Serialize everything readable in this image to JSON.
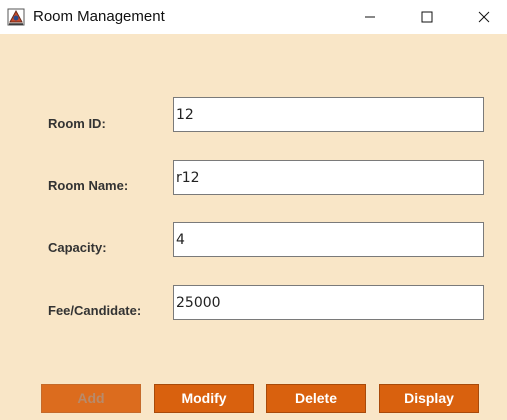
{
  "window": {
    "title": "Room Management",
    "icon": "java-app-icon",
    "controls": {
      "minimize": "minimize-icon",
      "maximize": "maximize-icon",
      "close": "close-icon"
    }
  },
  "form": {
    "fields": [
      {
        "label": "Room ID:",
        "value": "12"
      },
      {
        "label": "Room Name:",
        "value": "r12"
      },
      {
        "label": "Capacity:",
        "value": "4"
      },
      {
        "label": "Fee/Candidate:",
        "value": "25000"
      }
    ]
  },
  "buttons": {
    "add": {
      "label": "Add",
      "enabled": false
    },
    "modify": {
      "label": "Modify",
      "enabled": true
    },
    "delete": {
      "label": "Delete",
      "enabled": true
    },
    "display": {
      "label": "Display",
      "enabled": true
    }
  },
  "colors": {
    "background": "#f9e6c7",
    "button": "#d9610e",
    "button_text": "#ffffff",
    "button_disabled_text": "#b88a6a"
  }
}
